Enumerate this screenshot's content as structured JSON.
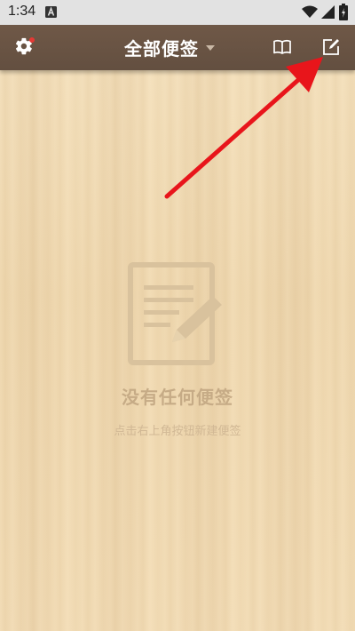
{
  "status_bar": {
    "time": "1:34"
  },
  "toolbar": {
    "title": "全部便签",
    "settings_has_notification": true
  },
  "empty_state": {
    "title": "没有任何便签",
    "hint": "点击右上角按钮新建便签"
  },
  "colors": {
    "toolbar": "#6a5444",
    "annotation_arrow": "#e8151b"
  }
}
